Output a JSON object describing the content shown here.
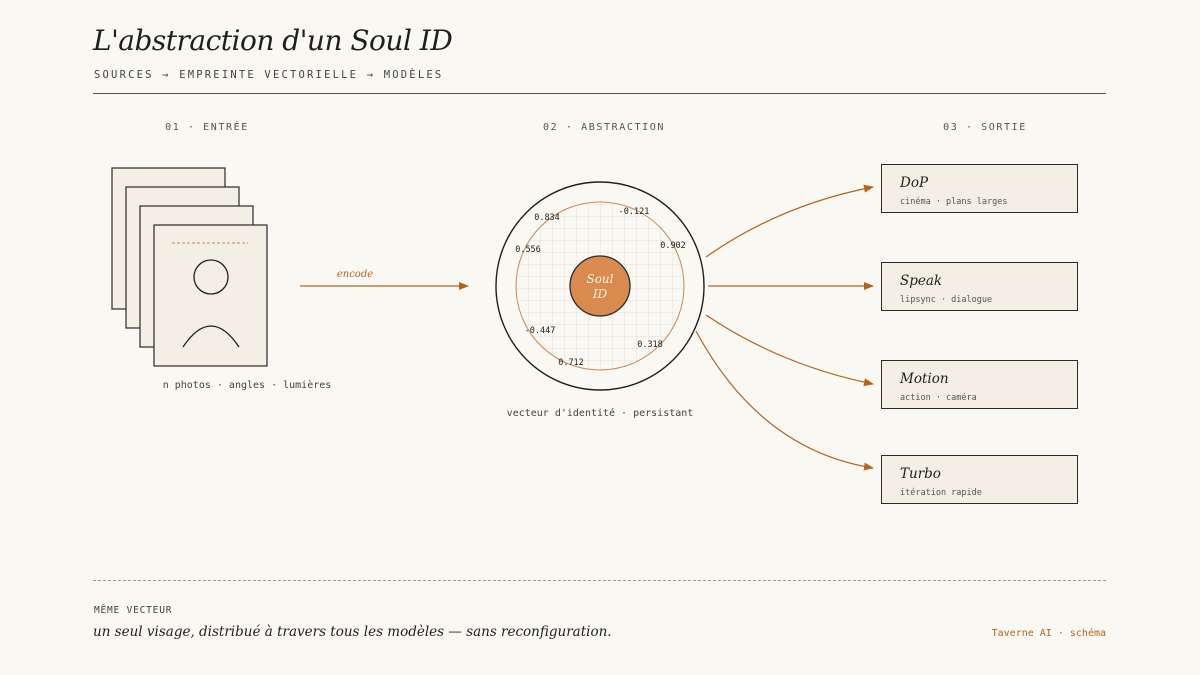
{
  "header": {
    "title": "L'abstraction d'un Soul ID",
    "subtitle": "SOURCES → EMPREINTE VECTORIELLE → MODÈLES"
  },
  "steps": [
    {
      "label": "01 · ENTRÉE"
    },
    {
      "label": "02 · ABSTRACTION"
    },
    {
      "label": "03 · SORTIE"
    }
  ],
  "input": {
    "caption": "n photos · angles · lumières"
  },
  "arrow": {
    "label": "encode"
  },
  "core": {
    "label_line1": "Soul",
    "label_line2": "ID",
    "caption": "vecteur d'identité · persistant",
    "values": [
      "0.834",
      "-0.121",
      "0.902",
      "0.556",
      "-0.447",
      "0.318",
      "0.712"
    ]
  },
  "outputs": [
    {
      "name": "DoP",
      "sub": "cinéma · plans larges"
    },
    {
      "name": "Speak",
      "sub": "lipsync · dialogue"
    },
    {
      "name": "Motion",
      "sub": "action · caméra"
    },
    {
      "name": "Turbo",
      "sub": "itération rapide"
    }
  ],
  "footer": {
    "label": "MÊME VECTEUR",
    "text": "un seul visage, distribué à travers tous les modèles — sans reconfiguration.",
    "credit": "Taverne AI · schéma"
  },
  "colors": {
    "accent": "#b5641f",
    "core_fill": "#d98a4e",
    "paper": "#f4efe5",
    "background": "#faf8f3"
  }
}
